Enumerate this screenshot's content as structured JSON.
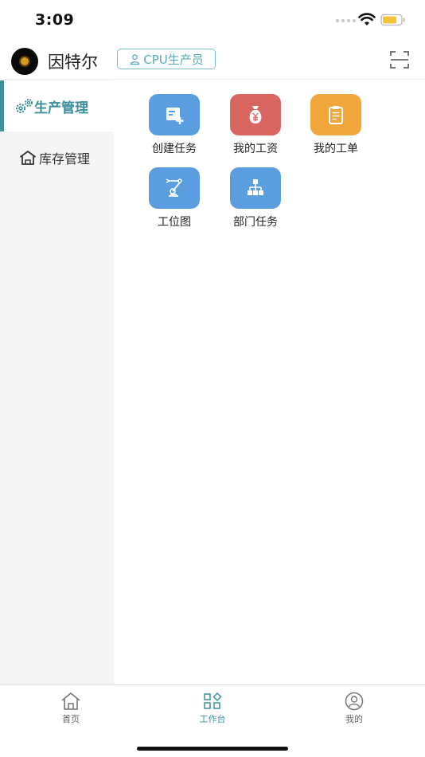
{
  "status_bar": {
    "time": "3:09"
  },
  "header": {
    "company_name": "因特尔",
    "role_badge": "CPU生产员"
  },
  "sidebar": {
    "items": [
      {
        "label": "生产管理",
        "active": true
      },
      {
        "label": "库存管理",
        "active": false
      }
    ]
  },
  "grid": {
    "items": [
      {
        "label": "创建任务",
        "color": "#5a9ee0",
        "icon": "create-task-icon"
      },
      {
        "label": "我的工资",
        "color": "#d96561",
        "icon": "money-bag-icon"
      },
      {
        "label": "我的工单",
        "color": "#f0a63a",
        "icon": "clipboard-icon"
      },
      {
        "label": "工位图",
        "color": "#5a9ee0",
        "icon": "robot-arm-icon"
      },
      {
        "label": "部门任务",
        "color": "#5a9ee0",
        "icon": "org-chart-icon"
      }
    ]
  },
  "bottom_nav": {
    "items": [
      {
        "label": "首页",
        "icon": "home-icon",
        "active": false
      },
      {
        "label": "工作台",
        "icon": "workbench-icon",
        "active": true
      },
      {
        "label": "我的",
        "icon": "profile-icon",
        "active": false
      }
    ]
  },
  "colors": {
    "accent": "#3d8f9a",
    "badge": "#5aaab5",
    "sidebar_bg": "#f5f5f5"
  }
}
